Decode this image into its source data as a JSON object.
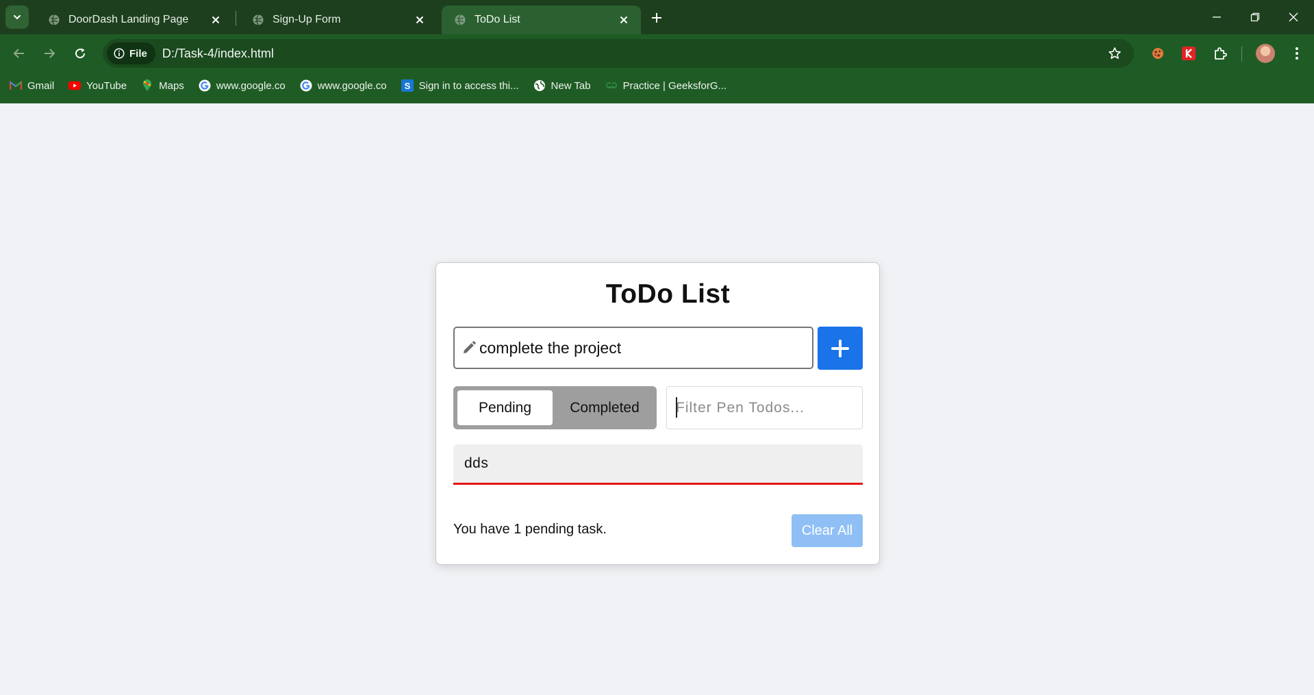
{
  "browser": {
    "tabs": [
      {
        "title": "DoorDash Landing Page",
        "active": false
      },
      {
        "title": "Sign-Up Form",
        "active": false
      },
      {
        "title": "ToDo List",
        "active": true
      }
    ],
    "address": {
      "chip_label": "File",
      "url": "D:/Task-4/index.html"
    },
    "bookmarks": [
      {
        "label": "Gmail",
        "icon": "gmail-icon"
      },
      {
        "label": "YouTube",
        "icon": "youtube-icon"
      },
      {
        "label": "Maps",
        "icon": "maps-icon"
      },
      {
        "label": "www.google.co",
        "icon": "google-icon"
      },
      {
        "label": "www.google.co",
        "icon": "google-icon"
      },
      {
        "label": "Sign in to access thi...",
        "icon": "s-icon"
      },
      {
        "label": "New Tab",
        "icon": "globe-icon"
      },
      {
        "label": "Practice | GeeksforG...",
        "icon": "gfg-icon"
      }
    ],
    "colors": {
      "frame": "#1d3f1e",
      "toolbar": "#1f5c25"
    }
  },
  "app": {
    "title": "ToDo List",
    "task_input": {
      "value": "complete the project"
    },
    "add_icon": "plus-icon",
    "segments": {
      "pending": "Pending",
      "completed": "Completed",
      "selected": "Pending"
    },
    "filter": {
      "placeholder": "Filter Pen Todos..."
    },
    "tasks": [
      {
        "text": "dds",
        "status": "pending"
      }
    ],
    "footer": {
      "message": "You have 1 pending task.",
      "clear_label": "Clear All"
    },
    "colors": {
      "primary": "#1a73e8",
      "task_underline": "#e41212",
      "clear_disabled": "#8fbff5"
    }
  }
}
